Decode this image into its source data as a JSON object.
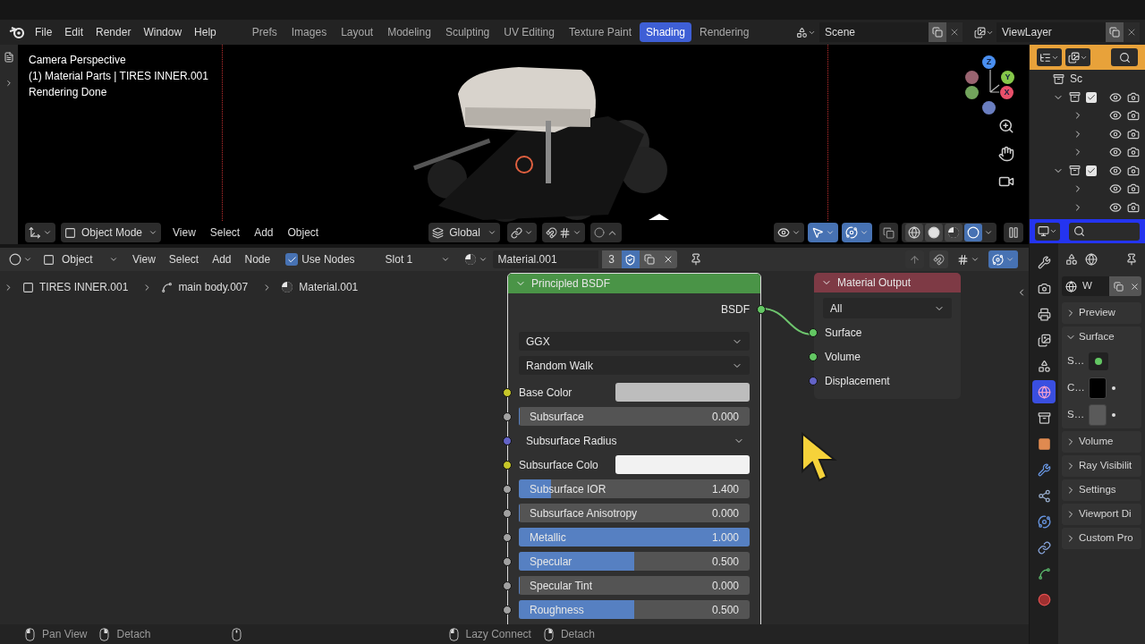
{
  "menu": [
    "File",
    "Edit",
    "Render",
    "Window",
    "Help"
  ],
  "workspaces": [
    {
      "label": "Prefs",
      "selected": false
    },
    {
      "label": "Images",
      "selected": false
    },
    {
      "label": "Layout",
      "selected": false
    },
    {
      "label": "Modeling",
      "selected": false
    },
    {
      "label": "Sculpting",
      "selected": false
    },
    {
      "label": "UV Editing",
      "selected": false
    },
    {
      "label": "Texture Paint",
      "selected": false
    },
    {
      "label": "Shading",
      "selected": true
    },
    {
      "label": "Rendering",
      "selected": false
    }
  ],
  "scene": "Scene",
  "view_layer": "ViewLayer",
  "viewport": {
    "overlay_text": [
      "Camera Perspective",
      "(1) Material Parts | TIRES INNER.001",
      "Rendering Done"
    ],
    "axes": [
      "Z",
      "Y",
      "X"
    ],
    "mode": "Object Mode",
    "menus": [
      "View",
      "Select",
      "Add",
      "Object"
    ],
    "orientation": "Global",
    "gizmos_on": true,
    "overlays_on": true,
    "shading": [
      {
        "kind": "wireframe",
        "selected": false
      },
      {
        "kind": "solid",
        "selected": false
      },
      {
        "kind": "material",
        "selected": false
      },
      {
        "kind": "rendered",
        "selected": true
      }
    ]
  },
  "outliner": {
    "root": "Sc",
    "collections": [
      {
        "expanded": true,
        "checked": true,
        "children": [
          {
            "expanded": false
          },
          {
            "expanded": false
          },
          {
            "expanded": false
          }
        ]
      },
      {
        "expanded": true,
        "checked": true,
        "children": [
          {
            "expanded": false
          },
          {
            "expanded": false
          }
        ]
      }
    ]
  },
  "node_editor": {
    "object": "Object",
    "menus": [
      "View",
      "Select",
      "Add",
      "Node"
    ],
    "use_nodes": {
      "label": "Use Nodes",
      "checked": true
    },
    "slot": "Slot 1",
    "material": "Material.001",
    "users": "3",
    "fake_user": true,
    "overlays_on": true,
    "breadcrumbs": [
      "TIRES INNER.001",
      "main body.007",
      "Material.001"
    ],
    "principled": {
      "title": "Principled BSDF",
      "outputs": [
        {
          "label": "BSDF",
          "color": "#63c763"
        }
      ],
      "dropdowns": [
        "GGX",
        "Random Walk"
      ],
      "inputs": [
        {
          "kind": "color",
          "label": "Base Color",
          "color": "#c7c729",
          "swatch": {
            "color": "#bdbdbd"
          }
        },
        {
          "kind": "slider",
          "label": "Subsurface",
          "value": "0.000",
          "level": 0,
          "color": "#a1a1a1"
        },
        {
          "kind": "vector",
          "label": "Subsurface Radius",
          "color": "#6363c7"
        },
        {
          "kind": "color",
          "label": "Subsurface Colo",
          "color": "#c7c729",
          "swatch": {
            "color": "#f2f2f2"
          }
        },
        {
          "kind": "slider",
          "label": "Subsurface IOR",
          "value": "1.400",
          "level": 0.14,
          "color": "#a1a1a1"
        },
        {
          "kind": "slider",
          "label": "Subsurface Anisotropy",
          "value": "0.000",
          "level": 0,
          "color": "#a1a1a1"
        },
        {
          "kind": "slider",
          "label": "Metallic",
          "value": "1.000",
          "level": 1,
          "color": "#a1a1a1"
        },
        {
          "kind": "slider",
          "label": "Specular",
          "value": "0.500",
          "level": 0.5,
          "color": "#a1a1a1"
        },
        {
          "kind": "slider",
          "label": "Specular Tint",
          "value": "0.000",
          "level": 0,
          "color": "#a1a1a1"
        },
        {
          "kind": "slider",
          "label": "Roughness",
          "value": "0.500",
          "level": 0.5,
          "color": "#a1a1a1"
        }
      ]
    },
    "output": {
      "title": "Material Output",
      "target": "All",
      "inputs": [
        {
          "label": "Surface",
          "color": "#63c763"
        },
        {
          "label": "Volume",
          "color": "#63c763"
        },
        {
          "label": "Displacement",
          "color": "#6363c7"
        }
      ]
    }
  },
  "properties": {
    "tabs": [
      {
        "kind": "tool",
        "selected": false
      },
      {
        "kind": "render",
        "selected": false
      },
      {
        "kind": "output",
        "selected": false
      },
      {
        "kind": "view_layer",
        "selected": false
      },
      {
        "kind": "scene",
        "selected": false
      },
      {
        "kind": "world",
        "selected": true
      },
      {
        "kind": "collection",
        "selected": false
      },
      {
        "kind": "object",
        "selected": false
      },
      {
        "kind": "modifiers",
        "selected": false
      },
      {
        "kind": "particles",
        "selected": false
      },
      {
        "kind": "physics",
        "selected": false
      },
      {
        "kind": "constraints",
        "selected": false
      },
      {
        "kind": "data",
        "selected": false
      },
      {
        "kind": "material",
        "selected": false
      }
    ],
    "world": "W",
    "panels": [
      {
        "label": "Preview",
        "expanded": false
      },
      {
        "label": "Surface",
        "expanded": true,
        "rows": [
          {
            "kind": "socket",
            "label": "S…",
            "color": "#63c763"
          },
          {
            "kind": "color",
            "label": "C…",
            "swatch": {
              "color": "#000000"
            }
          },
          {
            "kind": "color",
            "label": "S…",
            "swatch": {
              "color": "#5a5a5a"
            }
          }
        ]
      },
      {
        "label": "Volume",
        "expanded": false
      },
      {
        "label": "Ray Visibilit",
        "expanded": false
      },
      {
        "label": "Settings",
        "expanded": false
      },
      {
        "label": "Viewport Di",
        "expanded": false
      },
      {
        "label": "Custom Pro",
        "expanded": false
      }
    ]
  },
  "status": {
    "left": [
      {
        "kind": "left",
        "label": "Pan View"
      },
      {
        "kind": "right",
        "label": "Detach"
      },
      {
        "kind": "middle"
      }
    ],
    "right": [
      {
        "kind": "left",
        "label": "Lazy Connect"
      },
      {
        "kind": "right",
        "label": "Detach"
      }
    ]
  }
}
